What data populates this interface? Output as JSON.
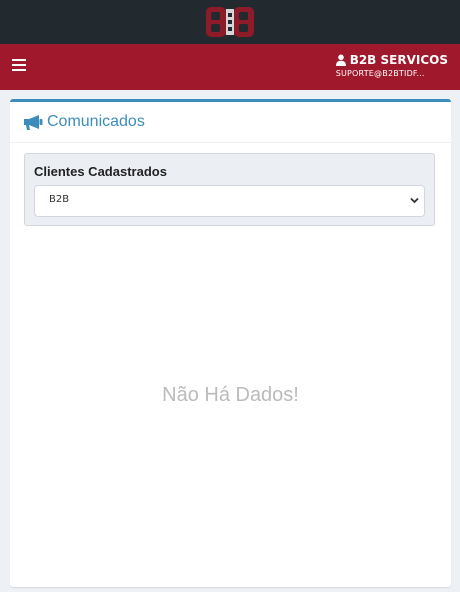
{
  "header": {
    "logo_text": "B2B"
  },
  "navbar": {
    "user_name": "B2B SERVICOS",
    "user_email": "SUPORTE@B2BTIDF..."
  },
  "card": {
    "title": "Comunicados",
    "filter": {
      "label": "Clientes Cadastrados",
      "selected": "B2B"
    },
    "empty_message": "Não Há Dados!"
  },
  "colors": {
    "topbar": "#222a30",
    "navbar": "#a0182b",
    "accent": "#3c8dbc"
  },
  "icons": {
    "menu": "hamburger-icon",
    "user": "user-icon",
    "title": "megaphone-icon",
    "select": "chevron-down-icon"
  }
}
